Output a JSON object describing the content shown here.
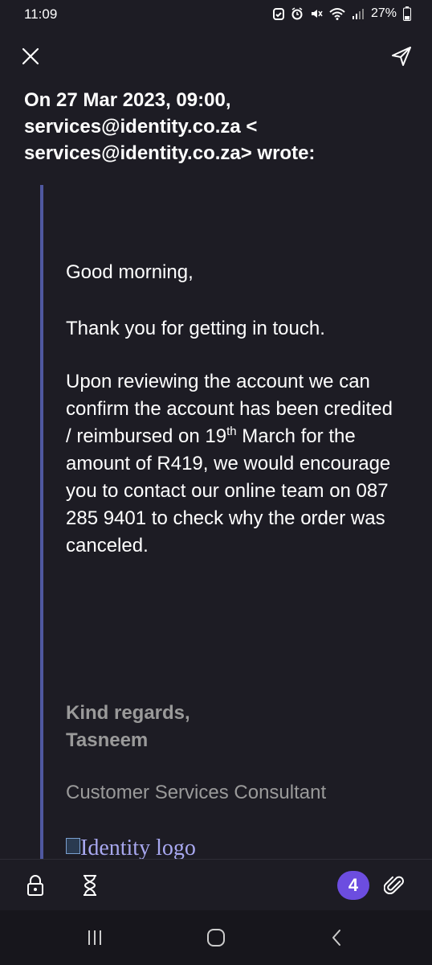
{
  "status_bar": {
    "time": "11:09",
    "battery": "27%",
    "icons": [
      "battery-saver-icon",
      "alarm-icon",
      "mute-icon",
      "wifi-icon",
      "signal-icon",
      "battery-icon"
    ]
  },
  "topbar": {
    "close_icon": "close-icon",
    "send_icon": "send-icon"
  },
  "email": {
    "header_line1": "On 27 Mar 2023, 09:00,",
    "header_line2": "services@identity.co.za <",
    "header_line3": "services@identity.co.za> wrote:",
    "greeting": "Good morning,",
    "thanks": "Thank you for getting in touch.",
    "body_part1": "Upon reviewing the account we can confirm the account has been credited / reimbursed on 19",
    "body_sup": "th",
    "body_part2": " March for the amount of R419, we would encourage you to contact our online team on 087 285 9401 to check why the order was canceled.",
    "regards": "Kind regards,",
    "signer": "Tasneem",
    "role": "Customer Services Consultant",
    "logo_alt": "Identity logo"
  },
  "toolbar": {
    "attachment_count": "4",
    "accent_color": "#6c4de0"
  },
  "colors": {
    "background": "#1d1c24",
    "quote_bar": "#4f58a0",
    "muted_text": "#9a9a9a"
  }
}
